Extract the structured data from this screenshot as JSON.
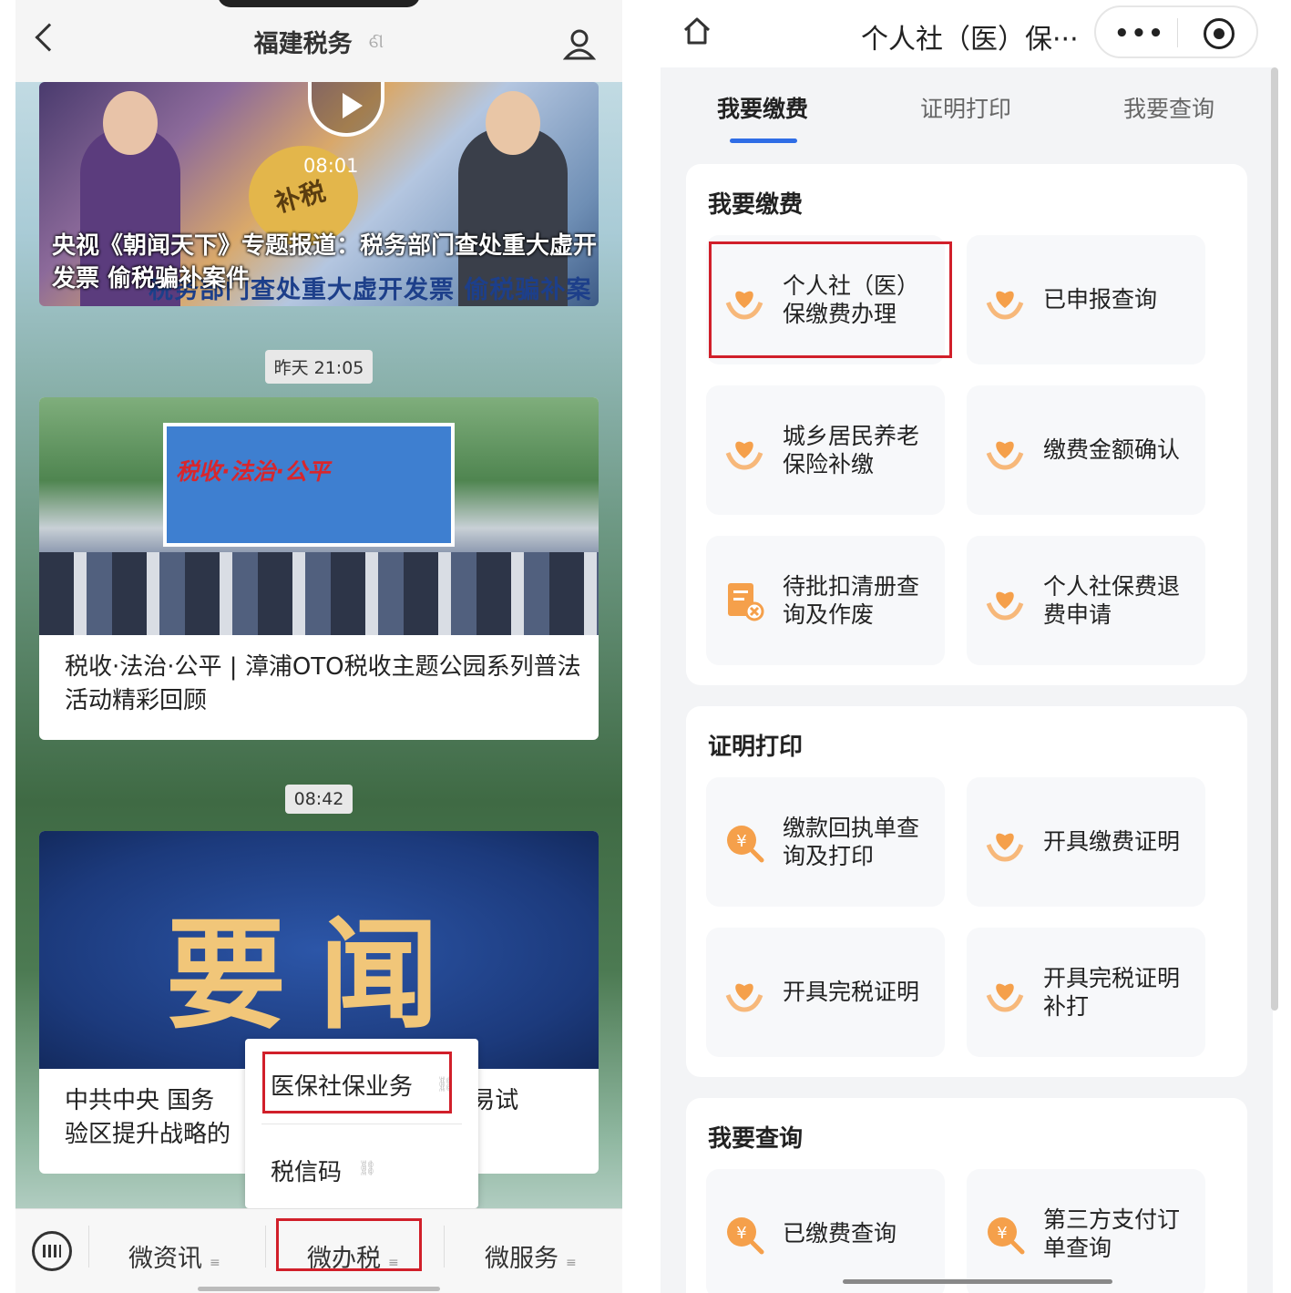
{
  "left": {
    "nav": {
      "title": "福建税务",
      "fingerprint": "ଣ"
    },
    "article1": {
      "duration": "08:01",
      "caption": "央视《朝闻天下》专题报道：税务部门查处重大虚开发票 偷税骗补案件",
      "subtitle": "税务部门查处重大虚开发票 偷税骗补案件",
      "bag_text": "补税"
    },
    "time1": "昨天 21:05",
    "article2": {
      "banner": "税收·法治·公平",
      "title": "税收·法治·公平 | 漳浦OTO税收主题公园系列普法活动精彩回顾"
    },
    "time2": "08:42",
    "article3": {
      "big": "要闻",
      "title_left": "中共中央 国务",
      "title_right": "由贸易试",
      "title_line2": "验区提升战略的"
    },
    "popup": {
      "item1": "医保社保业务",
      "item2": "税信码"
    },
    "bottom_menu": [
      {
        "label": "微资讯"
      },
      {
        "label": "微办税"
      },
      {
        "label": "微服务"
      }
    ]
  },
  "right": {
    "title": "个人社（医）保···",
    "tabs": [
      "我要缴费",
      "证明打印",
      "我要查询"
    ],
    "sections": [
      {
        "heading": "我要缴费",
        "tiles": [
          {
            "label": "个人社（医）保缴费办理",
            "icon": "heart-hand-icon"
          },
          {
            "label": "已申报查询",
            "icon": "heart-hand-icon"
          },
          {
            "label": "城乡居民养老保险补缴",
            "icon": "heart-hand-icon"
          },
          {
            "label": "缴费金额确认",
            "icon": "heart-hand-icon"
          },
          {
            "label": "待批扣清册查询及作废",
            "icon": "document-cancel-icon"
          },
          {
            "label": "个人社保费退费申请",
            "icon": "heart-hand-icon"
          }
        ]
      },
      {
        "heading": "证明打印",
        "tiles": [
          {
            "label": "缴款回执单查询及打印",
            "icon": "yuan-search-icon"
          },
          {
            "label": "开具缴费证明",
            "icon": "heart-hand-icon"
          },
          {
            "label": "开具完税证明",
            "icon": "heart-hand-icon"
          },
          {
            "label": "开具完税证明补打",
            "icon": "heart-hand-icon"
          }
        ]
      },
      {
        "heading": "我要查询",
        "tiles": [
          {
            "label": "已缴费查询",
            "icon": "yuan-search-icon"
          },
          {
            "label": "第三方支付订单查询",
            "icon": "yuan-search-icon"
          }
        ]
      }
    ],
    "colors": {
      "accent": "#2f6de6",
      "icon_orange": "#f5a04b",
      "highlight_red": "#d11f2a"
    }
  }
}
